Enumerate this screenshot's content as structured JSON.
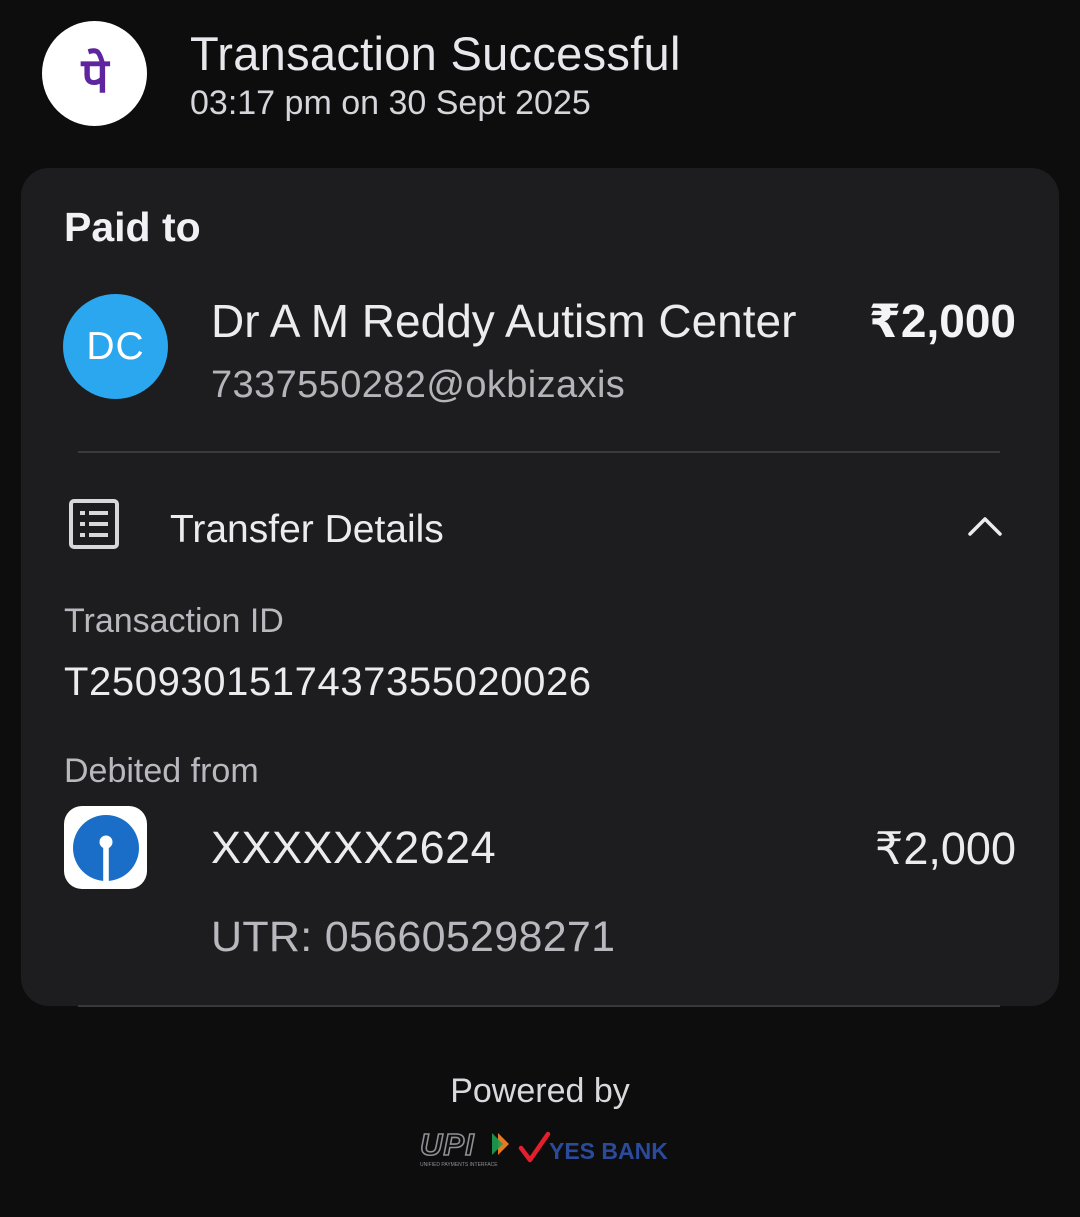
{
  "header": {
    "app_logo_char": "पे",
    "title": "Transaction Successful",
    "datetime": "03:17 pm on 30 Sept 2025"
  },
  "paid_to": {
    "label": "Paid to",
    "avatar_initials": "DC",
    "name": "Dr A M Reddy Autism Center",
    "amount": "₹2,000",
    "upi_id": "7337550282@okbizaxis"
  },
  "transfer_details": {
    "label": "Transfer Details",
    "expanded": true,
    "transaction_id_label": "Transaction ID",
    "transaction_id": "T2509301517437355020026",
    "debited_from_label": "Debited from",
    "account_number": "XXXXXX2624",
    "amount": "₹2,000",
    "utr": "UTR: 056605298271"
  },
  "footer": {
    "powered_by": "Powered by",
    "upi_text": "UPI",
    "upi_tagline": "UNIFIED PAYMENTS INTERFACE",
    "bank_text": "YES BANK"
  },
  "colors": {
    "background": "#0d0d0e",
    "card": "#1d1d1f",
    "phonepe_purple": "#5f259f",
    "avatar_blue": "#2aa7ee",
    "sbi_blue": "#1a6ec8",
    "yes_bank_blue": "#2b4a9c",
    "yes_bank_red": "#e31e2d"
  }
}
